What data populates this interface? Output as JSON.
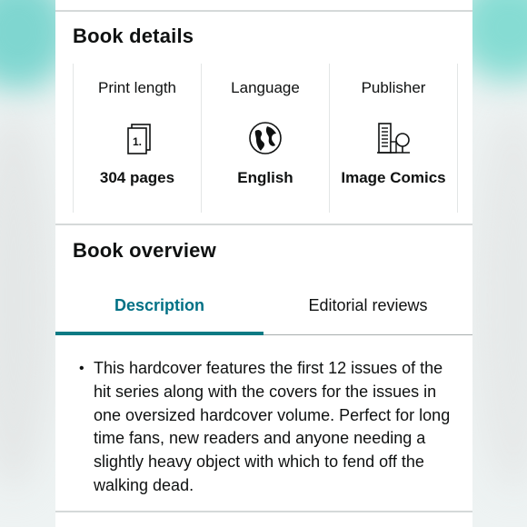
{
  "book_details": {
    "title": "Book details",
    "items": [
      {
        "label": "Print length",
        "icon": "page-count-icon",
        "icon_text": "1.",
        "value": "304 pages"
      },
      {
        "label": "Language",
        "icon": "globe-icon",
        "value": "English"
      },
      {
        "label": "Publisher",
        "icon": "building-icon",
        "value": "Image Comics"
      }
    ]
  },
  "book_overview": {
    "title": "Book overview",
    "tabs": [
      {
        "label": "Description",
        "active": true
      },
      {
        "label": "Editorial reviews",
        "active": false
      }
    ],
    "description": [
      "This hardcover features the first 12 issues of the hit series along with the covers for the issues in one oversized hardcover volume. Perfect for long time fans, new readers and anyone needing a slightly heavy object with which to fend off the walking dead."
    ]
  },
  "colors": {
    "accent": "#007185",
    "tab_underline": "#0b7a84",
    "text": "#0f1111",
    "divider": "#d5d9d9"
  }
}
